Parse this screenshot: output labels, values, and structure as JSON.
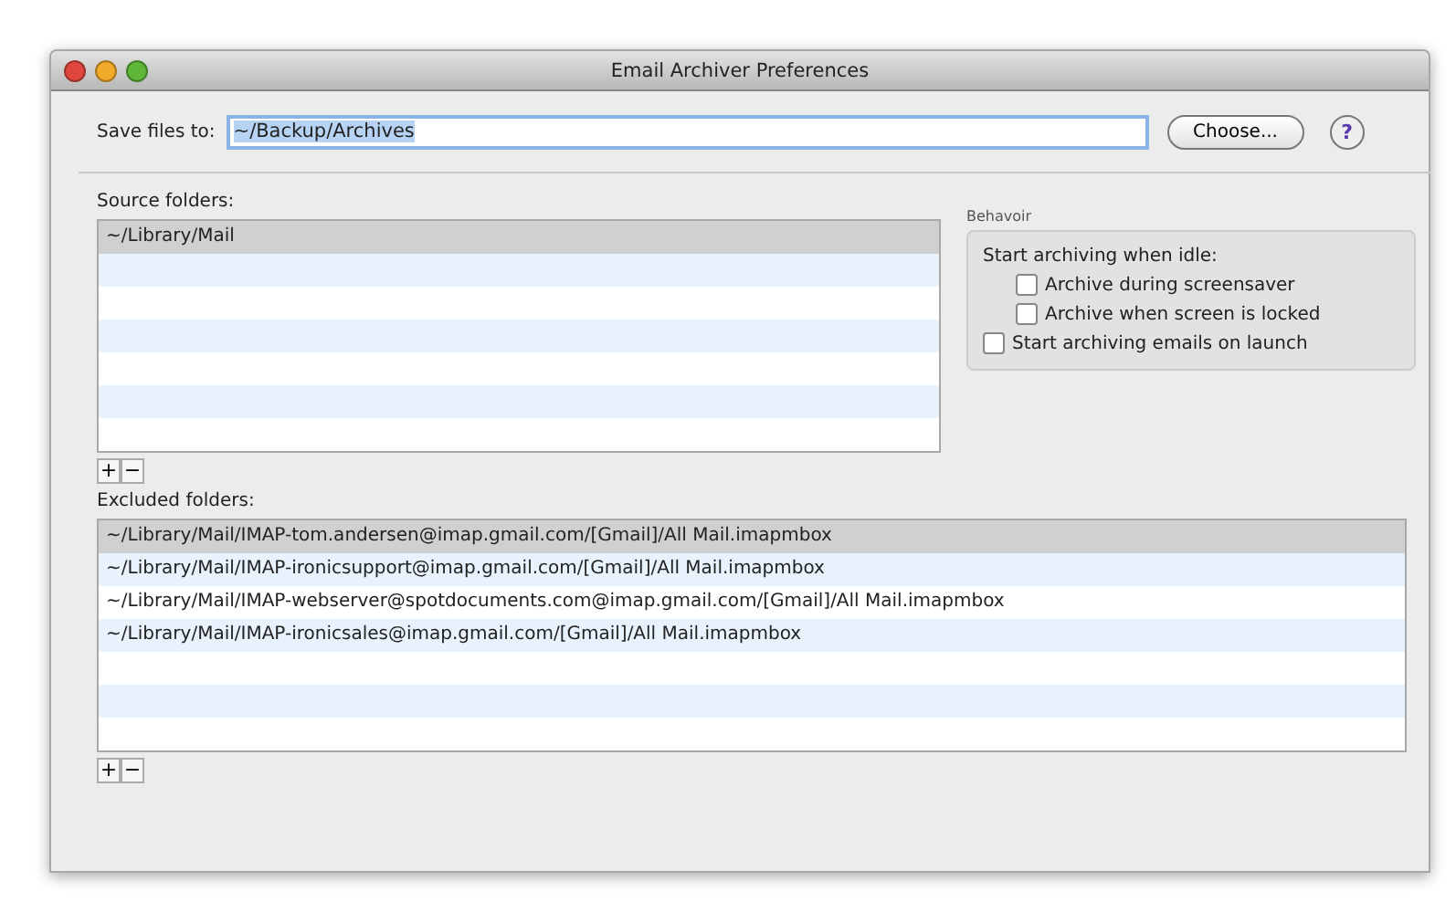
{
  "window": {
    "title": "Email Archiver Preferences"
  },
  "save_files": {
    "label": "Save files to:",
    "value": "~/Backup/Archives",
    "button": "Choose...",
    "help": "?"
  },
  "source_folders": {
    "label": "Source folders:",
    "items": [
      {
        "path": "~/Library/Mail",
        "selected": true
      }
    ],
    "add": "+",
    "remove": "−"
  },
  "behavior": {
    "title": "Behavoir",
    "items": [
      {
        "kind": "label",
        "text": "Start archiving when idle:",
        "children": [
          {
            "kind": "checkbox",
            "text": "Archive during screensaver",
            "checked": false
          },
          {
            "kind": "checkbox",
            "text": "Archive when screen is locked",
            "checked": false
          }
        ]
      },
      {
        "kind": "checkbox",
        "text": "Start archiving emails on launch",
        "checked": false
      }
    ]
  },
  "excluded_folders": {
    "label": "Excluded folders:",
    "items": [
      {
        "path": "~/Library/Mail/IMAP-tom.andersen@imap.gmail.com/[Gmail]/All Mail.imapmbox",
        "selected": true
      },
      {
        "path": "~/Library/Mail/IMAP-ironicsupport@imap.gmail.com/[Gmail]/All Mail.imapmbox",
        "selected": false
      },
      {
        "path": "~/Library/Mail/IMAP-webserver@spotdocuments.com@imap.gmail.com/[Gmail]/All Mail.imapmbox",
        "selected": false
      },
      {
        "path": "~/Library/Mail/IMAP-ironicsales@imap.gmail.com/[Gmail]/All Mail.imapmbox",
        "selected": false
      }
    ],
    "add": "+",
    "remove": "−"
  }
}
